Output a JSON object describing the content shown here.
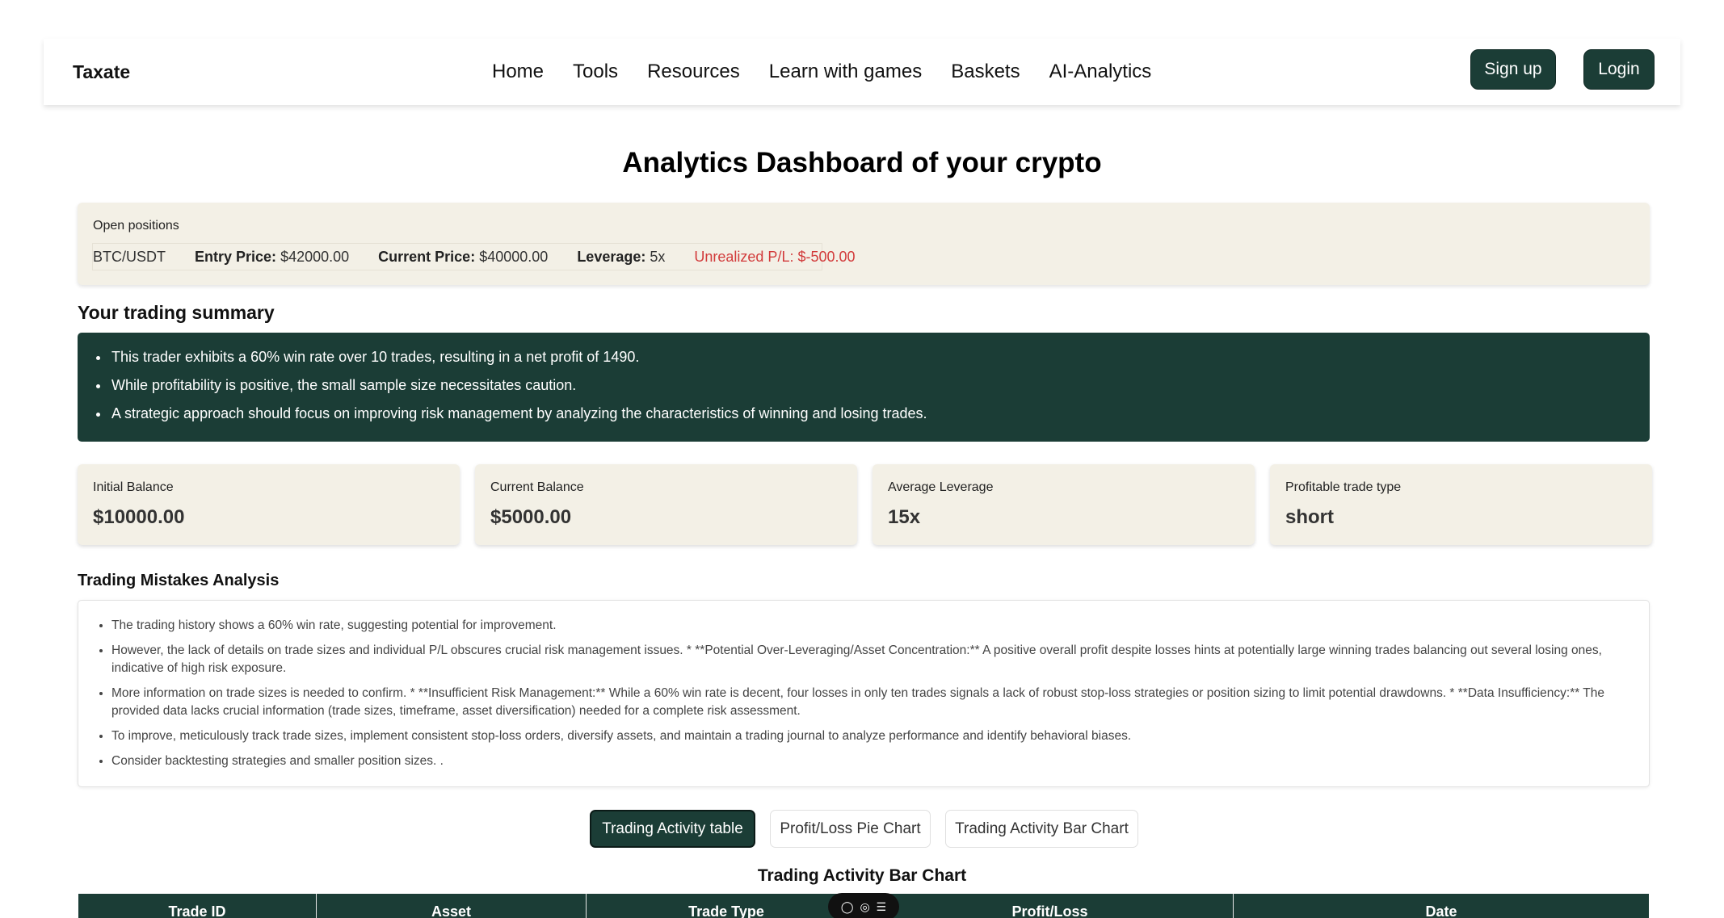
{
  "nav": {
    "brand": "Taxate",
    "links": [
      "Home",
      "Tools",
      "Resources",
      "Learn with games",
      "Baskets",
      "AI-Analytics"
    ],
    "signup": "Sign up",
    "login": "Login"
  },
  "page_title": "Analytics Dashboard of your crypto",
  "open_positions": {
    "label": "Open positions",
    "pair": "BTC/USDT",
    "entry_label": "Entry Price:",
    "entry_value": "$42000.00",
    "current_label": "Current Price:",
    "current_value": "$40000.00",
    "leverage_label": "Leverage:",
    "leverage_value": "5x",
    "pl_text": "Unrealized P/L: $-500.00",
    "pl_color": "#d23b3b"
  },
  "summary": {
    "heading": "Your trading summary",
    "items": [
      "This trader exhibits a 60% win rate over 10 trades, resulting in a net profit of 1490.",
      "While profitability is positive, the small sample size necessitates caution.",
      "A strategic approach should focus on improving risk management by analyzing the characteristics of winning and losing trades."
    ]
  },
  "stats": [
    {
      "label": "Initial Balance",
      "value": "$10000.00"
    },
    {
      "label": "Current Balance",
      "value": "$5000.00"
    },
    {
      "label": "Average Leverage",
      "value": "15x"
    },
    {
      "label": "Profitable trade type",
      "value": "short"
    }
  ],
  "mistakes": {
    "heading": "Trading Mistakes Analysis",
    "items": [
      "The trading history shows a 60% win rate, suggesting potential for improvement.",
      "However, the lack of details on trade sizes and individual P/L obscures crucial risk management issues. * **Potential Over-Leveraging/Asset Concentration:** A positive overall profit despite losses hints at potentially large winning trades balancing out several losing ones, indicative of high risk exposure.",
      "More information on trade sizes is needed to confirm. * **Insufficient Risk Management:** While a 60% win rate is decent, four losses in only ten trades signals a lack of robust stop-loss strategies or position sizing to limit potential drawdowns. * **Data Insufficiency:** The provided data lacks crucial information (trade sizes, timeframe, asset diversification) needed for a complete risk assessment.",
      "To improve, meticulously track trade sizes, implement consistent stop-loss orders, diversify assets, and maintain a trading journal to analyze performance and identify behavioral biases.",
      "Consider backtesting strategies and smaller position sizes. ."
    ]
  },
  "tabs": {
    "table": "Trading Activity table",
    "pie": "Profit/Loss Pie Chart",
    "bar": "Trading Activity Bar Chart"
  },
  "section_title": "Trading Activity Bar Chart",
  "table": {
    "headers": [
      "Trade ID",
      "Asset",
      "Trade Type",
      "Profit/Loss",
      "Date"
    ]
  },
  "colors": {
    "brand_dark": "#1b3d36",
    "card_bg": "#f3f0e6"
  }
}
